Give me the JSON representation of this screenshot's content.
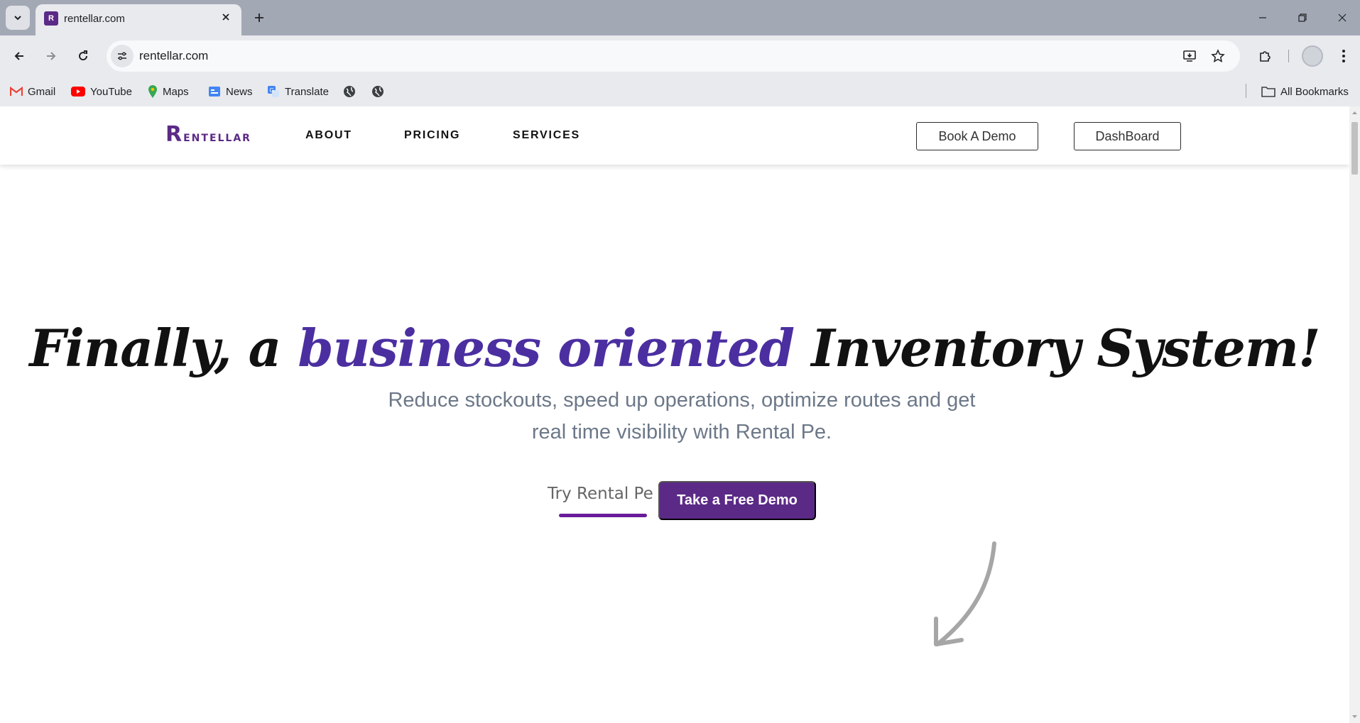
{
  "browser": {
    "tab": {
      "title": "rentellar.com",
      "favicon_text": "R"
    },
    "url": "rentellar.com",
    "bookmarks": [
      {
        "label": "Gmail",
        "icon": "gmail-icon"
      },
      {
        "label": "YouTube",
        "icon": "youtube-icon"
      },
      {
        "label": "Maps",
        "icon": "maps-icon"
      },
      {
        "label": "News",
        "icon": "news-icon"
      },
      {
        "label": "Translate",
        "icon": "translate-icon"
      }
    ],
    "all_bookmarks_label": "All Bookmarks"
  },
  "site": {
    "logo_first": "R",
    "logo_rest": "entellar",
    "nav": [
      "ABOUT",
      "PRICING",
      "SERVICES"
    ],
    "book_demo": "Book A Demo",
    "dashboard": "DashBoard",
    "brand_color": "#5b2a86"
  },
  "hero": {
    "title_pre": "Finally, a ",
    "title_accent": "business oriented",
    "title_post": " Inventory System!",
    "subtitle": "Reduce stockouts, speed up operations, optimize routes and get real time visibility with Rental Pe.",
    "try_label": "Try Rental Pe",
    "demo_label": "Take a Free Demo",
    "accent_color": "#4b2fa0"
  }
}
